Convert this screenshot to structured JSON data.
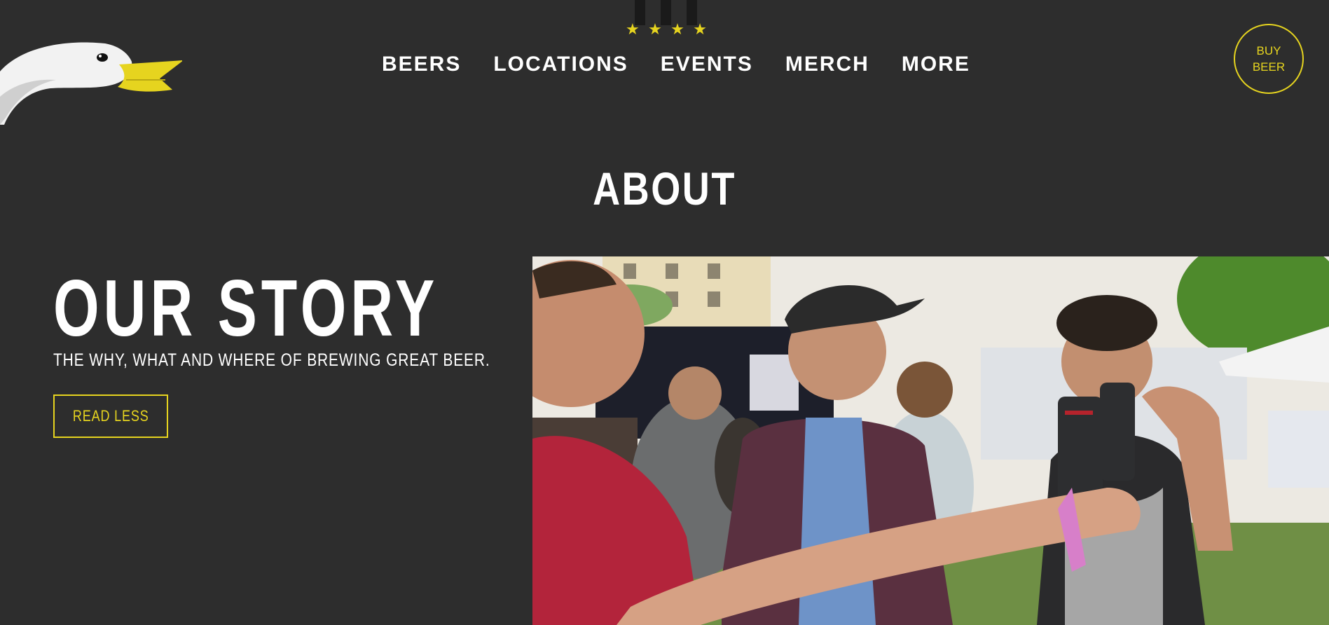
{
  "header": {
    "logo_icon": "swan-head-logo-icon",
    "star_icon": "star-icon",
    "stars": [
      "★",
      "★",
      "★",
      "★"
    ],
    "nav": [
      {
        "label": "BEERS"
      },
      {
        "label": "LOCATIONS"
      },
      {
        "label": "EVENTS"
      },
      {
        "label": "MERCH"
      },
      {
        "label": "MORE"
      }
    ],
    "buy_beer": {
      "line1": "BUY",
      "line2": "BEER"
    }
  },
  "page": {
    "title": "ABOUT"
  },
  "story": {
    "heading": "OUR STORY",
    "subtitle": "THE WHY, WHAT AND WHERE OF BREWING GREAT BEER.",
    "read_less_label": "READ LESS",
    "photo_subject": "friends-toasting-beer-cans-photo"
  },
  "colors": {
    "background": "#2d2d2d",
    "accent": "#e6d41f",
    "text": "#ffffff"
  }
}
